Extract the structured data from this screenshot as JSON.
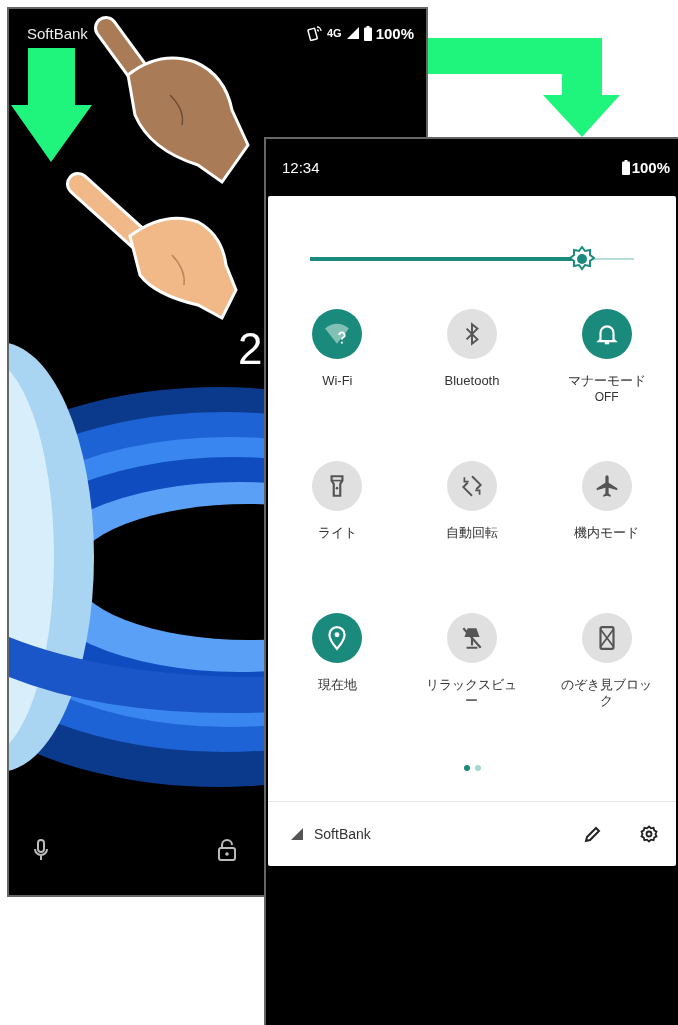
{
  "lock_screen": {
    "status_bar": {
      "carrier": "SoftBank",
      "network": "4G",
      "battery": "100%"
    },
    "clock_fragment": "2"
  },
  "quick_settings": {
    "status_bar": {
      "time": "12:34",
      "battery": "100%"
    },
    "brightness": {
      "level": 0.84
    },
    "tiles": [
      {
        "kind": "wifi",
        "label": "Wi-Fi",
        "on": true
      },
      {
        "kind": "bluetooth",
        "label": "Bluetooth",
        "on": false
      },
      {
        "kind": "bell",
        "label": "マナーモード",
        "sublabel": "OFF",
        "on": true
      },
      {
        "kind": "flashlight",
        "label": "ライト",
        "on": false
      },
      {
        "kind": "rotate",
        "label": "自動回転",
        "on": false
      },
      {
        "kind": "airplane",
        "label": "機内モード",
        "on": false
      },
      {
        "kind": "location",
        "label": "現在地",
        "on": true
      },
      {
        "kind": "lamp",
        "label": "リラックスビュー",
        "on": false
      },
      {
        "kind": "peek",
        "label": "のぞき見ブロック",
        "on": false
      }
    ],
    "pages": [
      {
        "selected": true
      },
      {
        "selected": false
      }
    ],
    "footer": {
      "carrier": "SoftBank"
    }
  }
}
